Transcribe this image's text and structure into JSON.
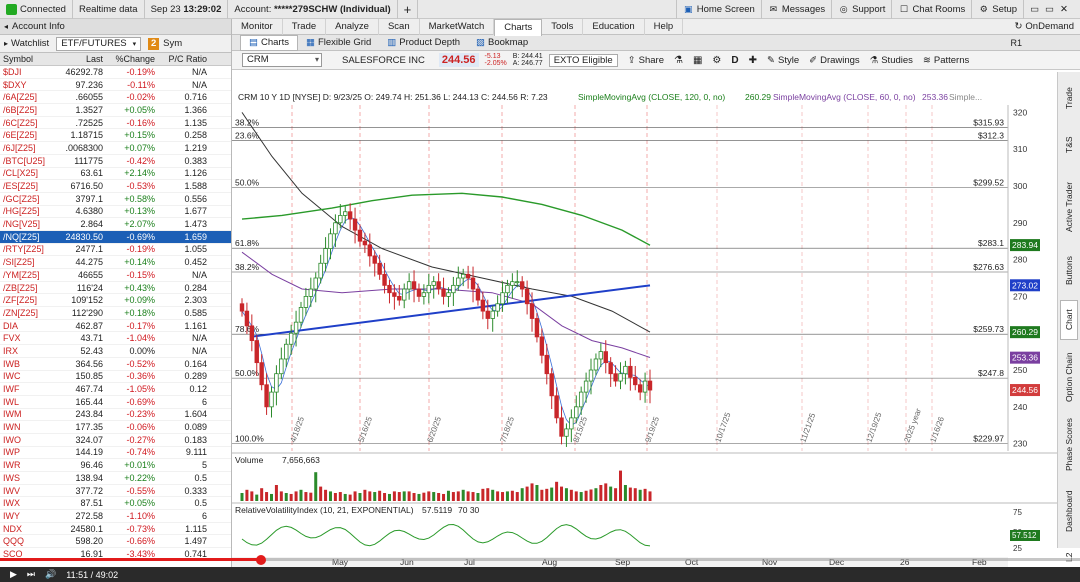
{
  "topbar": {
    "connected": "Connected",
    "realtime": "Realtime data",
    "date": "Sep 23",
    "time": "13:29:02",
    "account_label": "Account:",
    "account": "*****279SCHW (Individual)",
    "add": "+",
    "home_screen": "Home Screen",
    "messages": "Messages",
    "support": "Support",
    "chat_rooms": "Chat Rooms",
    "setup": "Setup"
  },
  "left": {
    "account_info": "Account Info",
    "tabs": {
      "watchlist": "Watchlist",
      "list": "ETF/FUTURES",
      "badge": "2",
      "sym": "Sym"
    },
    "headers": {
      "symbol": "Symbol",
      "last": "Last",
      "change": "%Change",
      "pc": "P/C Ratio"
    },
    "rows": [
      {
        "s": "$DJI",
        "l": "46292.78",
        "c": "-0.19%",
        "p": "N/A"
      },
      {
        "s": "$DXY",
        "l": "97.236",
        "c": "-0.11%",
        "p": "N/A"
      },
      {
        "s": "/6A[Z25]",
        "l": ".66055",
        "c": "-0.02%",
        "p": "0.716"
      },
      {
        "s": "/6B[Z25]",
        "l": "1.3527",
        "c": "+0.05%",
        "p": "1.366"
      },
      {
        "s": "/6C[Z25]",
        "l": ".72525",
        "c": "-0.16%",
        "p": "1.135"
      },
      {
        "s": "/6E[Z25]",
        "l": "1.18715",
        "c": "+0.15%",
        "p": "0.258"
      },
      {
        "s": "/6J[Z25]",
        "l": ".0068300",
        "c": "+0.07%",
        "p": "1.219"
      },
      {
        "s": "/BTC[U25]",
        "l": "111775",
        "c": "-0.42%",
        "p": "0.383"
      },
      {
        "s": "/CL[X25]",
        "l": "63.61",
        "c": "+2.14%",
        "p": "1.126"
      },
      {
        "s": "/ES[Z25]",
        "l": "6716.50",
        "c": "-0.53%",
        "p": "1.588"
      },
      {
        "s": "/GC[Z25]",
        "l": "3797.1",
        "c": "+0.58%",
        "p": "0.556"
      },
      {
        "s": "/HG[Z25]",
        "l": "4.6380",
        "c": "+0.13%",
        "p": "1.677"
      },
      {
        "s": "/NG[V25]",
        "l": "2.864",
        "c": "+2.07%",
        "p": "1.473"
      },
      {
        "s": "/NQ[Z25]",
        "l": "24830.50",
        "c": "-0.69%",
        "p": "1.659",
        "sel": true
      },
      {
        "s": "/RTY[Z25]",
        "l": "2477.1",
        "c": "-0.19%",
        "p": "1.055"
      },
      {
        "s": "/SI[Z25]",
        "l": "44.275",
        "c": "+0.14%",
        "p": "0.452"
      },
      {
        "s": "/YM[Z25]",
        "l": "46655",
        "c": "-0.15%",
        "p": "N/A"
      },
      {
        "s": "/ZB[Z25]",
        "l": "116'24",
        "c": "+0.43%",
        "p": "0.284"
      },
      {
        "s": "/ZF[Z25]",
        "l": "109'152",
        "c": "+0.09%",
        "p": "2.303"
      },
      {
        "s": "/ZN[Z25]",
        "l": "112'290",
        "c": "+0.18%",
        "p": "0.585"
      },
      {
        "s": "DIA",
        "l": "462.87",
        "c": "-0.17%",
        "p": "1.161"
      },
      {
        "s": "FVX",
        "l": "43.71",
        "c": "-1.04%",
        "p": "N/A"
      },
      {
        "s": "IRX",
        "l": "52.43",
        "c": "0.00%",
        "p": "N/A"
      },
      {
        "s": "IWB",
        "l": "364.56",
        "c": "-0.52%",
        "p": "0.164"
      },
      {
        "s": "IWC",
        "l": "150.85",
        "c": "-0.36%",
        "p": "0.289"
      },
      {
        "s": "IWF",
        "l": "467.74",
        "c": "-1.05%",
        "p": "0.12"
      },
      {
        "s": "IWL",
        "l": "165.44",
        "c": "-0.69%",
        "p": "6"
      },
      {
        "s": "IWM",
        "l": "243.84",
        "c": "-0.23%",
        "p": "1.604"
      },
      {
        "s": "IWN",
        "l": "177.35",
        "c": "-0.06%",
        "p": "0.089"
      },
      {
        "s": "IWO",
        "l": "324.07",
        "c": "-0.27%",
        "p": "0.183"
      },
      {
        "s": "IWP",
        "l": "144.19",
        "c": "-0.74%",
        "p": "9.111"
      },
      {
        "s": "IWR",
        "l": "96.46",
        "c": "+0.01%",
        "p": "5"
      },
      {
        "s": "IWS",
        "l": "138.94",
        "c": "+0.22%",
        "p": "0.5"
      },
      {
        "s": "IWV",
        "l": "377.72",
        "c": "-0.55%",
        "p": "0.333"
      },
      {
        "s": "IWX",
        "l": "87.51",
        "c": "+0.05%",
        "p": "0.5"
      },
      {
        "s": "IWY",
        "l": "272.58",
        "c": "-1.10%",
        "p": "6"
      },
      {
        "s": "NDX",
        "l": "24580.1",
        "c": "-0.73%",
        "p": "1.115"
      },
      {
        "s": "QQQ",
        "l": "598.20",
        "c": "-0.66%",
        "p": "1.497"
      },
      {
        "s": "SCO",
        "l": "16.91",
        "c": "-3.43%",
        "p": "0.741"
      }
    ]
  },
  "menu": {
    "items": [
      "Monitor",
      "Trade",
      "Analyze",
      "Scan",
      "MarketWatch",
      "Charts",
      "Tools",
      "Education",
      "Help"
    ],
    "active": "Charts",
    "ondemand": "OnDemand"
  },
  "subtabs": {
    "items": [
      "Charts",
      "Flexible Grid",
      "Product Depth",
      "Bookmap"
    ],
    "active": "Charts",
    "r1": "R1"
  },
  "toolbar": {
    "symbol": "CRM",
    "name": "SALESFORCE INC",
    "price": "244.56",
    "change": "-5.13",
    "change_pct": "-2.05%",
    "bid": "B: 244.41",
    "ask": "A: 246.77",
    "exto": "EXTO Eligible",
    "share": "Share",
    "period": "D",
    "style": "Style",
    "drawings": "Drawings",
    "studies": "Studies",
    "patterns": "Patterns"
  },
  "chart_data": {
    "type": "candlestick",
    "header": "CRM 10 Y 1D [NYSE]  D: 9/23/25  O: 249.74  H: 251.36  L: 244.13  C: 244.56  R: 7.23",
    "study_1": "SimpleMovingAvg (CLOSE, 120, 0, no)",
    "study_1_value": "260.29",
    "study_2": "SimpleMovingAvg (CLOSE, 60, 0, no)",
    "study_2_value": "253.36",
    "study_3": "Simple...",
    "price_axis": [
      "320",
      "310",
      "300",
      "290",
      "280",
      "270",
      "260",
      "250",
      "240",
      "230"
    ],
    "ylim": [
      228,
      322
    ],
    "price_tags": [
      {
        "label": "283.94",
        "value": 283.94,
        "color": "#1f7a1f"
      },
      {
        "label": "273.02",
        "value": 273.02,
        "color": "#1f3fc8"
      },
      {
        "label": "260.29",
        "value": 260.29,
        "color": "#1f7a1f"
      },
      {
        "label": "253.36",
        "value": 253.36,
        "color": "#7a3fa0"
      },
      {
        "label": "244.56",
        "value": 244.56,
        "color": "#d23c3c"
      }
    ],
    "fib_levels": [
      {
        "pct": "38.2%",
        "value": 315.93,
        "label": "$315.93"
      },
      {
        "pct": "23.6%",
        "value": 312.3,
        "label": "$312.3"
      },
      {
        "pct": "50.0%",
        "value": 299.52,
        "label": "$299.52"
      },
      {
        "pct": "61.8%",
        "value": 283.1,
        "label": "$283.1"
      },
      {
        "pct": "38.2%",
        "value": 276.63,
        "label": "$276.63"
      },
      {
        "pct": "78.6%",
        "value": 259.73,
        "label": "$259.73"
      },
      {
        "pct": "50.0%",
        "value": 247.8,
        "label": "$247.8"
      },
      {
        "pct": "100.0%",
        "value": 229.97,
        "label": "$229.97"
      }
    ],
    "closes": [
      266,
      262,
      258,
      252,
      246,
      240,
      244,
      249,
      253,
      257,
      260,
      263,
      267,
      270,
      272,
      275,
      279,
      283,
      287,
      290,
      292,
      293,
      291,
      288,
      285,
      284,
      281,
      279,
      276,
      273,
      271,
      270,
      269,
      272,
      274,
      272,
      270,
      271,
      273,
      274,
      272,
      270,
      271,
      273,
      275,
      276,
      275,
      272,
      269,
      266,
      264,
      266,
      268,
      271,
      273,
      274,
      274,
      272,
      268,
      264,
      259,
      254,
      249,
      243,
      237,
      232,
      234,
      237,
      240,
      244,
      247,
      250,
      253,
      255,
      252,
      249,
      247,
      249,
      251,
      248,
      246,
      244,
      247,
      244.56
    ],
    "date_labels": [
      "4/18/25",
      "5/16/25",
      "6/20/25",
      "7/18/25",
      "8/15/25",
      "9/19/25",
      "10/17/25",
      "11/21/25",
      "12/19/25",
      "2025 year",
      "1/16/26"
    ],
    "month_labels": [
      "May",
      "Jun",
      "Jul",
      "Aug",
      "Sep",
      "Oct",
      "Nov",
      "Dec",
      "26",
      "Feb"
    ],
    "volume": {
      "label": "Volume",
      "value": "7,656,663"
    },
    "volume_bars": [
      0.25,
      0.35,
      0.3,
      0.2,
      0.4,
      0.28,
      0.22,
      0.5,
      0.3,
      0.25,
      0.22,
      0.3,
      0.35,
      0.28,
      0.26,
      0.9,
      0.45,
      0.35,
      0.3,
      0.25,
      0.28,
      0.22,
      0.2,
      0.3,
      0.25,
      0.35,
      0.3,
      0.28,
      0.32,
      0.25,
      0.22,
      0.3,
      0.28,
      0.3,
      0.3,
      0.25,
      0.22,
      0.26,
      0.3,
      0.28,
      0.25,
      0.22,
      0.32,
      0.28,
      0.3,
      0.35,
      0.3,
      0.28,
      0.25,
      0.38,
      0.4,
      0.35,
      0.3,
      0.28,
      0.3,
      0.32,
      0.28,
      0.4,
      0.45,
      0.55,
      0.5,
      0.35,
      0.38,
      0.42,
      0.6,
      0.45,
      0.4,
      0.35,
      0.3,
      0.28,
      0.32,
      0.36,
      0.4,
      0.5,
      0.55,
      0.45,
      0.4,
      0.95,
      0.5,
      0.42,
      0.4,
      0.35,
      0.38,
      0.3
    ],
    "rvi": {
      "label": "RelativeVolatilityIndex (10, 21, EXPONENTIAL)",
      "value": "57.5119",
      "levels": "70  30",
      "value_tag": "57.512",
      "axis": [
        "75",
        "50",
        "25"
      ]
    }
  },
  "vtabs": [
    "Trade",
    "T&S",
    "Active Trader",
    "Buttons",
    "Chart",
    "Option Chain",
    "Phase Scores",
    "Dashboard",
    "L2"
  ],
  "video": {
    "time": "11:51 / 49:02",
    "progress": 0.242
  }
}
